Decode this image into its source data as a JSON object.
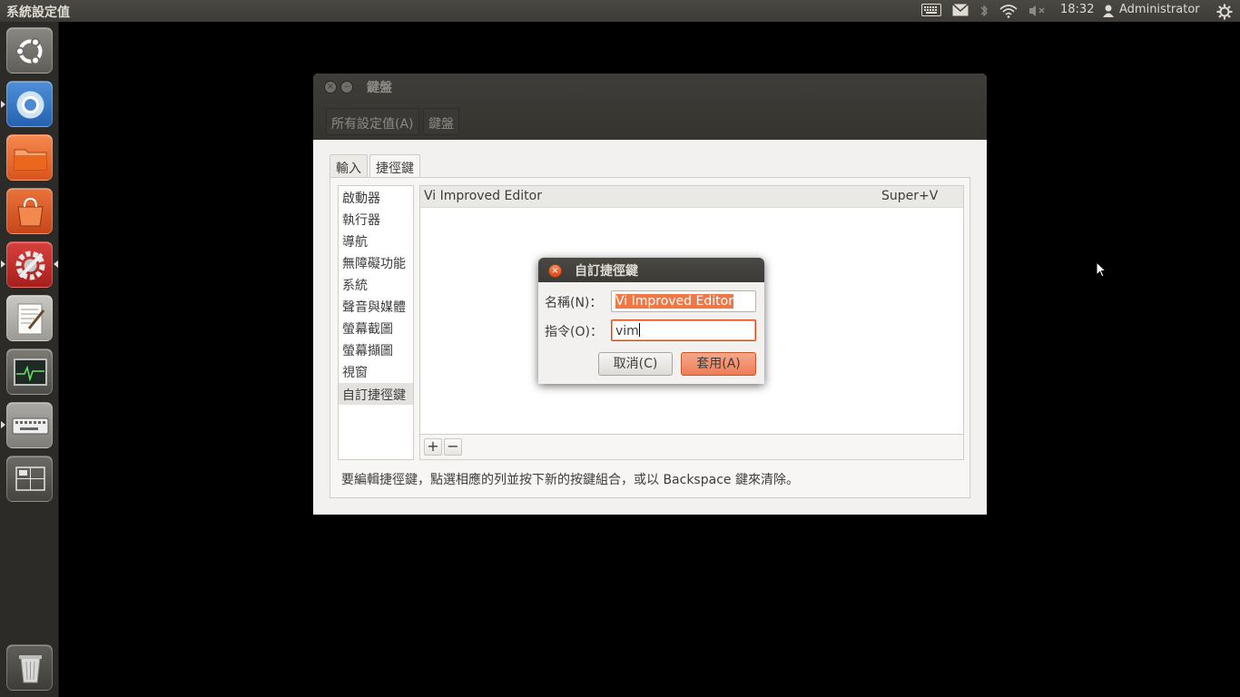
{
  "top_panel": {
    "app_title": "系統設定值",
    "time": "18:32",
    "user": "Administrator",
    "icons": [
      "keyboard-icon",
      "mail-icon",
      "bluetooth-icon",
      "wifi-icon",
      "volume-muted-icon",
      "user-icon",
      "power-gear-icon"
    ]
  },
  "launcher": {
    "items": [
      "ubuntu-dash",
      "chromium-browser",
      "files",
      "software-center",
      "system-settings",
      "text-editor",
      "system-monitor",
      "keyboard-settings",
      "workspace-switcher",
      "trash"
    ]
  },
  "window": {
    "title": "鍵盤",
    "breadcrumb": [
      "所有設定值(A)",
      "鍵盤"
    ],
    "tabs": [
      {
        "label": "輸入",
        "active": false
      },
      {
        "label": "捷徑鍵",
        "active": true
      }
    ],
    "categories": [
      "啟動器",
      "執行器",
      "導航",
      "無障礙功能",
      "系統",
      "聲音與媒體",
      "螢幕截圖",
      "螢幕擷圖",
      "視窗",
      "自訂捷徑鍵"
    ],
    "selected_category": "自訂捷徑鍵",
    "shortcuts": [
      {
        "name": "Vi Improved Editor",
        "keys": "Super+V"
      }
    ],
    "add_button": "+",
    "remove_button": "−",
    "hint": "要編輯捷徑鍵，點選相應的列並按下新的按鍵組合，或以 Backspace 鍵來清除。"
  },
  "dialog": {
    "title": "自訂捷徑鍵",
    "name_label": "名稱(N)：",
    "name_value": "Vi Improved Editor",
    "command_label": "指令(O)：",
    "command_value": "vim",
    "cancel_label": "取消(C)",
    "apply_label": "套用(A)"
  },
  "colors": {
    "accent": "#dd4814",
    "panel": "#3c3b37",
    "launcher_bg": "#2c2b28"
  }
}
